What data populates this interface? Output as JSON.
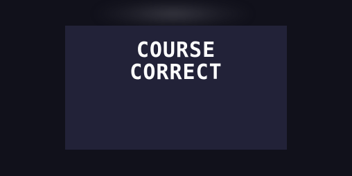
{
  "game": {
    "title_line_1": "COURSE",
    "title_line_2": "CORRECT"
  },
  "colors": {
    "page_background": "#11111b",
    "canvas_background": "#222238",
    "title_text": "#ffffff"
  }
}
